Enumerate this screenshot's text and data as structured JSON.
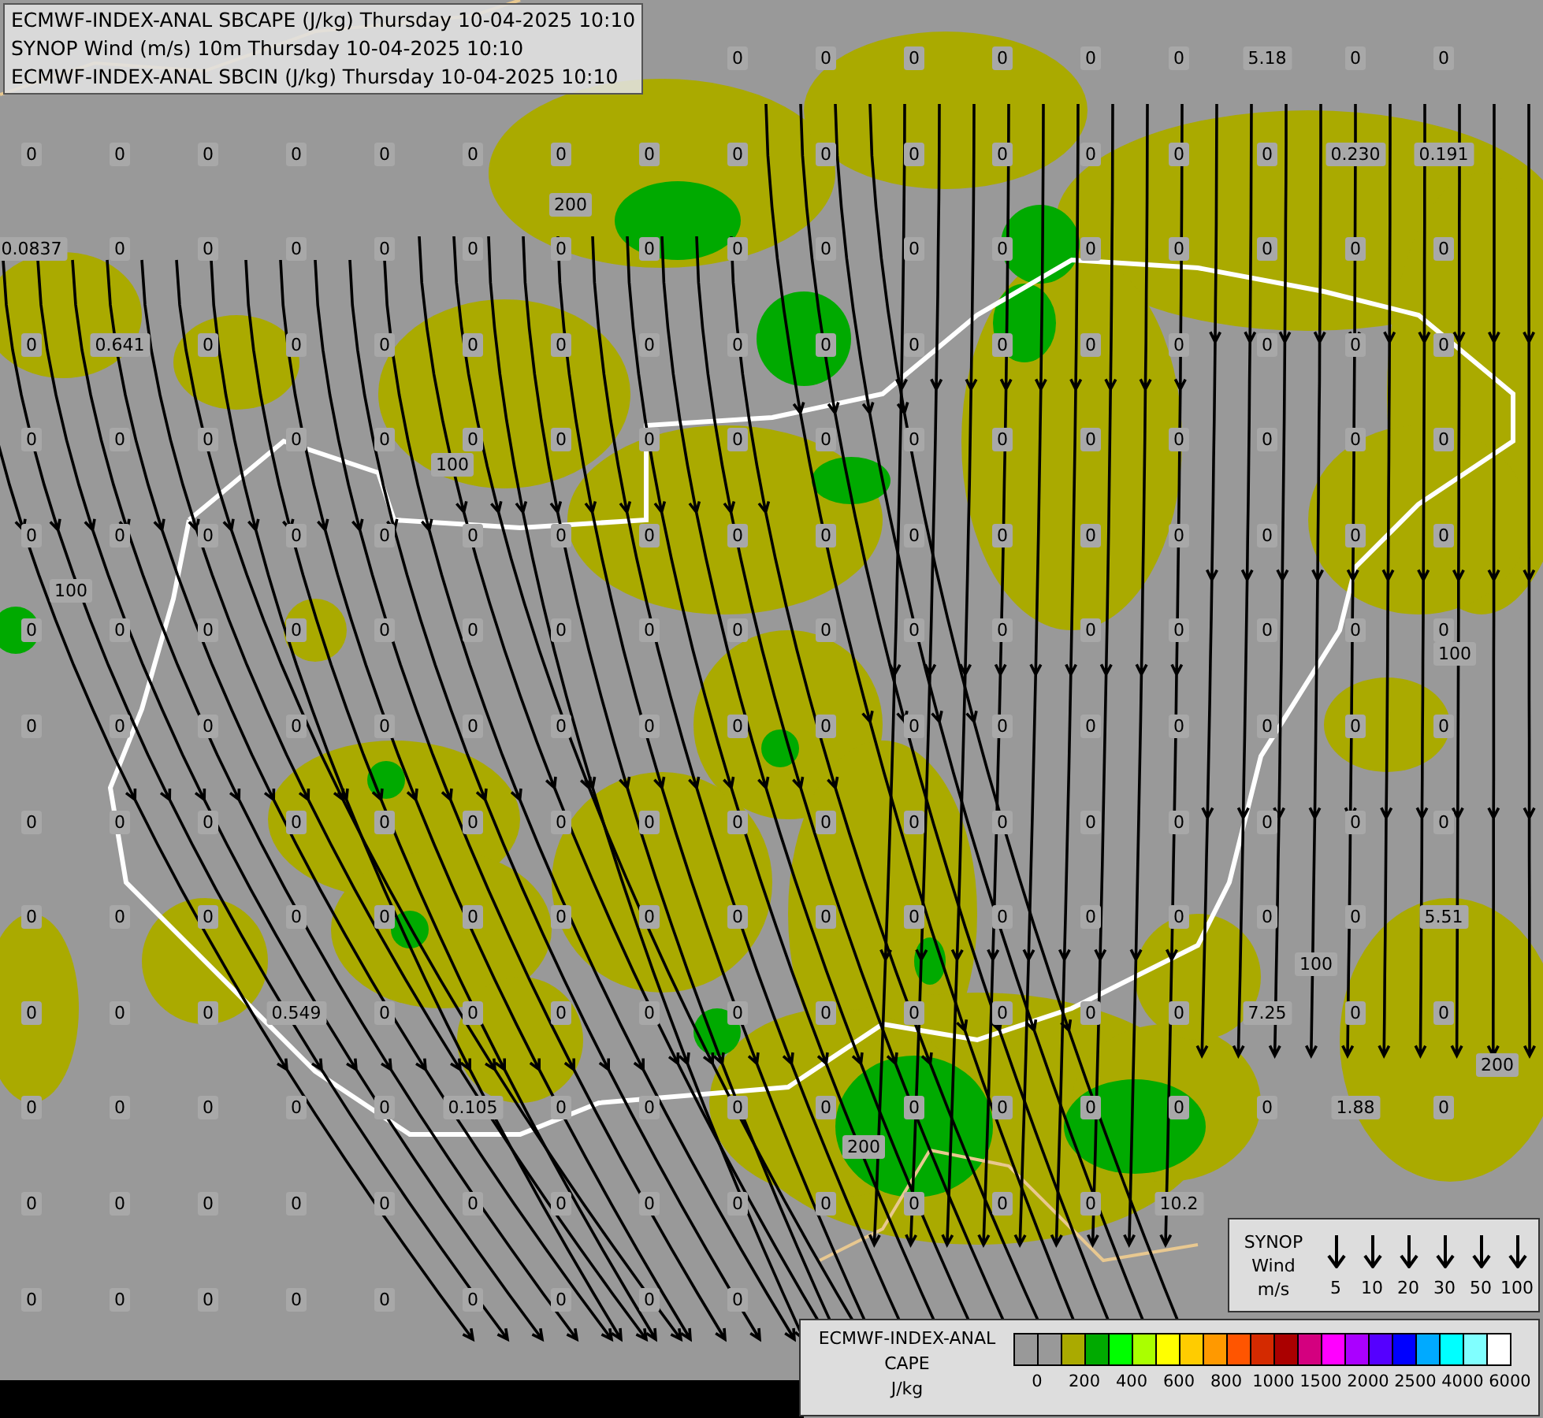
{
  "header": {
    "lines": [
      "ECMWF-INDEX-ANAL SBCAPE (J/kg) Thursday 10-04-2025 10:10",
      "SYNOP Wind (m/s) 10m Thursday 10-04-2025 10:10",
      "ECMWF-INDEX-ANAL SBCIN (J/kg) Thursday 10-04-2025 10:10"
    ]
  },
  "station_rows": [
    {
      "values": [
        "0",
        "0",
        "0",
        "0",
        "0",
        "0",
        "5.18",
        "0",
        "0"
      ]
    },
    {
      "values": [
        "0",
        "0",
        "0",
        "0",
        "0",
        "0",
        "0",
        "0",
        "0",
        "0",
        "0",
        "0",
        "0",
        "0",
        "0",
        "0.230",
        "0.191"
      ]
    },
    {
      "values": [
        "0.0837",
        "0",
        "0",
        "0",
        "0",
        "0",
        "0",
        "0",
        "0",
        "0",
        "0",
        "0",
        "0",
        "0",
        "0",
        "0",
        "0"
      ]
    },
    {
      "values": [
        "0",
        "0.641",
        "0",
        "0",
        "0",
        "0",
        "0",
        "0",
        "0",
        "0",
        "0",
        "0",
        "0",
        "0",
        "0",
        "0",
        "0"
      ]
    },
    {
      "values": [
        "0",
        "0",
        "0",
        "0",
        "0",
        "0",
        "0",
        "0",
        "0",
        "0",
        "0",
        "0",
        "0",
        "0",
        "0",
        "0",
        "0"
      ]
    },
    {
      "values": [
        "0",
        "0",
        "0",
        "0",
        "0",
        "0",
        "0",
        "0",
        "0",
        "0",
        "0",
        "0",
        "0",
        "0",
        "0",
        "0",
        "0"
      ]
    },
    {
      "values": [
        "0",
        "0",
        "0",
        "0",
        "0",
        "0",
        "0",
        "0",
        "0",
        "0",
        "0",
        "0",
        "0",
        "0",
        "0",
        "0",
        "0"
      ]
    },
    {
      "values": [
        "0",
        "0",
        "0",
        "0",
        "0",
        "0",
        "0",
        "0",
        "0",
        "0",
        "0",
        "0",
        "0",
        "0",
        "0",
        "0",
        "0"
      ]
    },
    {
      "values": [
        "0",
        "0",
        "0",
        "0",
        "0",
        "0",
        "0",
        "0",
        "0",
        "0",
        "0",
        "0",
        "0",
        "0",
        "0",
        "0",
        "0"
      ]
    },
    {
      "values": [
        "0",
        "0",
        "0",
        "0",
        "0",
        "0",
        "0",
        "0",
        "0",
        "0",
        "0",
        "0",
        "0",
        "0",
        "0",
        "0",
        "5.51"
      ]
    },
    {
      "values": [
        "0",
        "0",
        "0",
        "0.549",
        "0",
        "0",
        "0",
        "0",
        "0",
        "0",
        "0",
        "0",
        "0",
        "0",
        "7.25",
        "0",
        "0"
      ]
    },
    {
      "values": [
        "0",
        "0",
        "0",
        "0",
        "0",
        "0.105",
        "0",
        "0",
        "0",
        "0",
        "0",
        "0",
        "0",
        "0",
        "0",
        "1.88",
        "0"
      ]
    },
    {
      "values": [
        "0",
        "0",
        "0",
        "0",
        "0",
        "0",
        "0",
        "0",
        "0",
        "0",
        "0",
        "0",
        "0",
        "10.2"
      ]
    },
    {
      "values": [
        "0",
        "0",
        "0",
        "0",
        "0",
        "0",
        "0",
        "0",
        "0"
      ]
    }
  ],
  "contour_labels": [
    "200",
    "100",
    "100",
    "100",
    "200",
    "100",
    "200"
  ],
  "wind_legend": {
    "title_lines": [
      "SYNOP",
      "Wind",
      "m/s"
    ],
    "speeds": [
      "5",
      "10",
      "20",
      "30",
      "50",
      "100"
    ]
  },
  "cape_legend": {
    "title_lines": [
      "ECMWF-INDEX-ANAL",
      "CAPE",
      "J/kg"
    ],
    "swatches": [
      {
        "color": "#999999"
      },
      {
        "color": "#999999"
      },
      {
        "color": "#aaaa00"
      },
      {
        "color": "#00aa00"
      },
      {
        "color": "#00ff00"
      },
      {
        "color": "#aaff00"
      },
      {
        "color": "#ffff00"
      },
      {
        "color": "#ffcc00"
      },
      {
        "color": "#ff9900"
      },
      {
        "color": "#ff5500"
      },
      {
        "color": "#d42a00"
      },
      {
        "color": "#aa0000"
      },
      {
        "color": "#d4007f"
      },
      {
        "color": "#ff00ff"
      },
      {
        "color": "#aa00ff"
      },
      {
        "color": "#5500ff"
      },
      {
        "color": "#0000ff"
      },
      {
        "color": "#00aaff"
      },
      {
        "color": "#00ffff"
      },
      {
        "color": "#80ffff"
      },
      {
        "color": "#ffffff"
      }
    ],
    "ticks": [
      "0",
      "200",
      "400",
      "600",
      "800",
      "1000",
      "1500",
      "2000",
      "2500",
      "4000",
      "6000"
    ]
  }
}
